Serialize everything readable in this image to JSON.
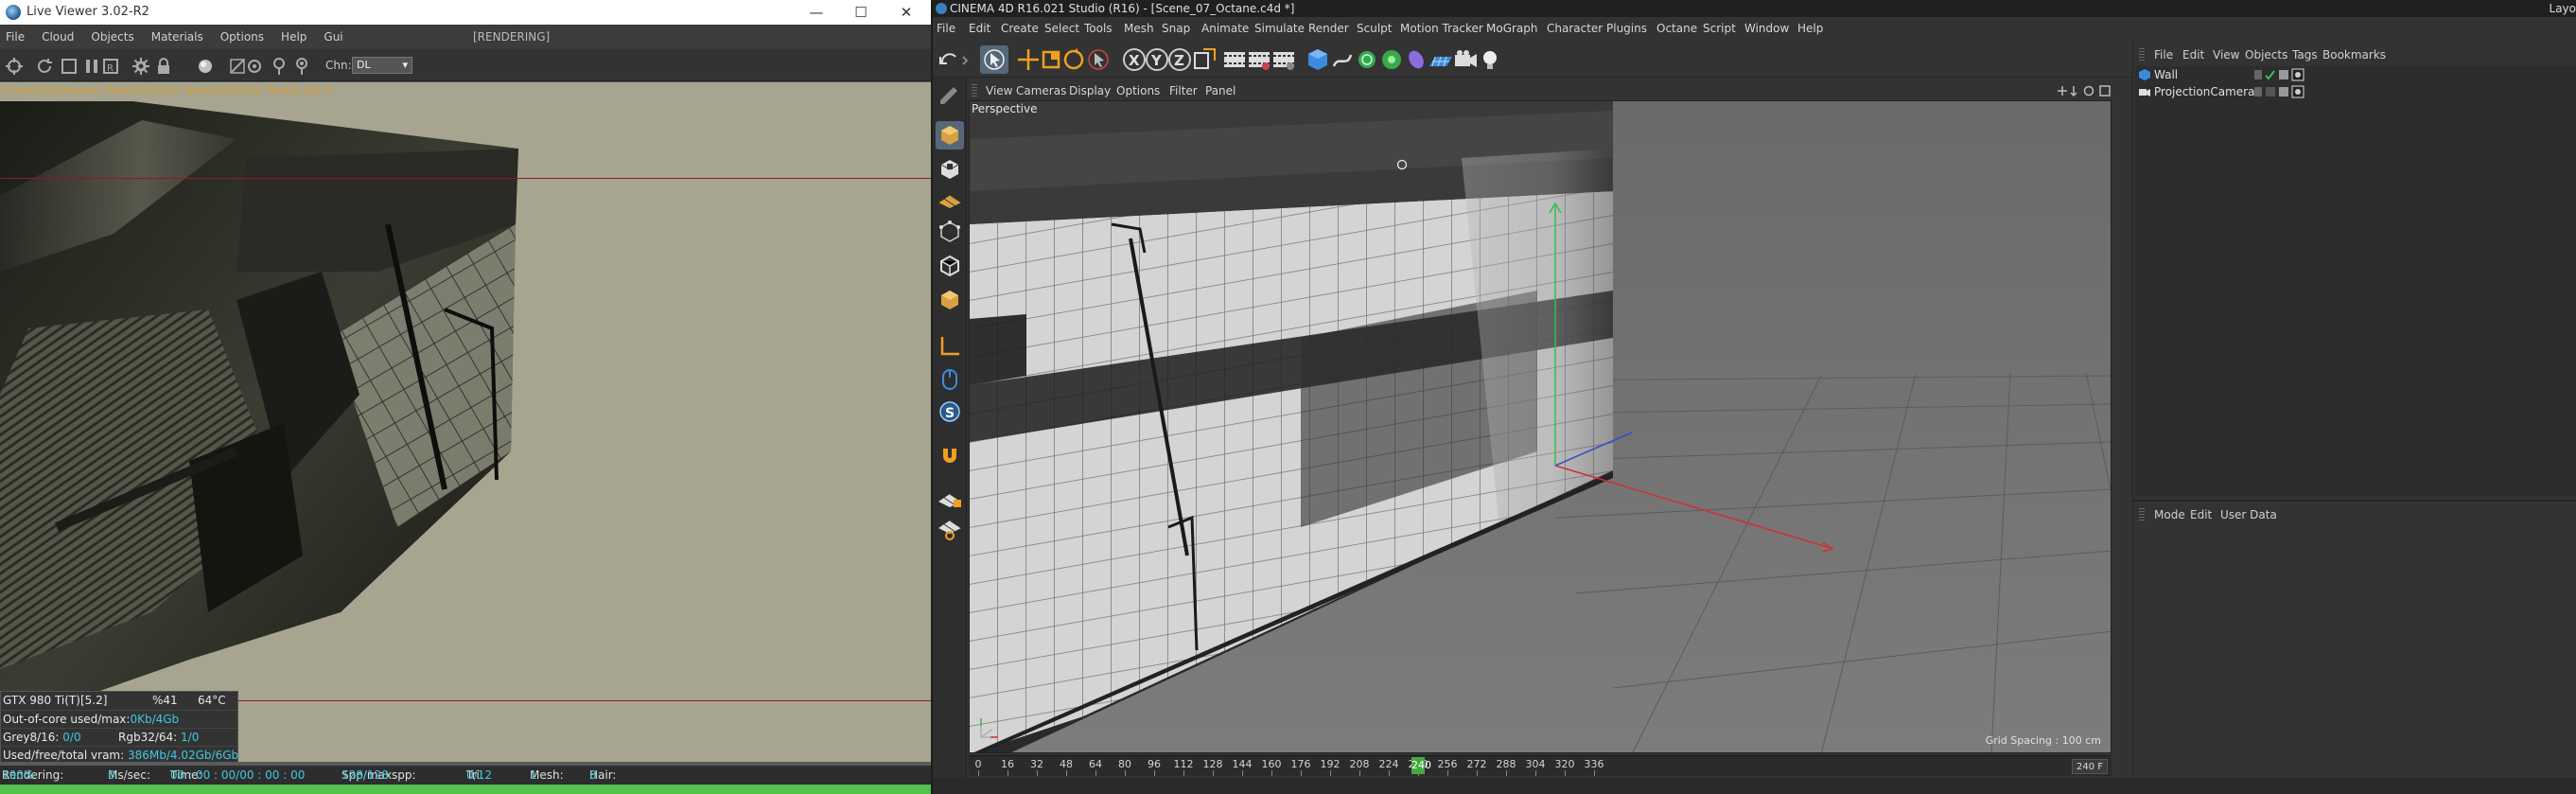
{
  "live_viewer": {
    "title": "Live Viewer 3.02-R2",
    "window_controls": {
      "minimize": "—",
      "maximize": "☐",
      "close": "✕"
    },
    "menu": [
      "File",
      "Cloud",
      "Objects",
      "Materials",
      "Options",
      "Help",
      "Gui"
    ],
    "status": "[RENDERING]",
    "channel_label": "Chn:",
    "channel_value": "DL",
    "warning": "CheckDirtyMeshes: MeshGenDirty Update(G)Dirty: Nodes Fail 0",
    "gpu": {
      "name": "GTX 980 Ti(T)[5.2]",
      "usage": "%41",
      "temp": "64°C",
      "out_of_core_label": "Out-of-core used/max:",
      "out_of_core_value": "0Kb/4Gb",
      "grey_label": "Grey8/16:",
      "grey_value": "0/0",
      "rgb_label": "Rgb32/64:",
      "rgb_value": "1/0",
      "vram_label": "Used/free/total vram:",
      "vram_value": "386Mb/4.02Gb/6Gb"
    },
    "footer": {
      "rendering_label": "Rendering:",
      "rendering_value": "100%",
      "ms_label": "Ms/sec:",
      "ms_value": "0",
      "time_label": "Time:",
      "time_value": "00 : 00 : 00/00 : 00 : 00",
      "spp_label": "Spp/maxspp:",
      "spp_value": "128/128",
      "tri_label": "Tri:",
      "tri_value": "0/12",
      "mesh_label": "Mesh:",
      "mesh_value": "1",
      "hair_label": "Hair:",
      "hair_value": "0"
    },
    "progress": 1.0
  },
  "c4d": {
    "title": "CINEMA 4D R16.021 Studio (R16) - [Scene_07_Octane.c4d *]",
    "layout_label": "Layo",
    "menu": [
      "File",
      "Edit",
      "Create",
      "Select",
      "Tools",
      "Mesh",
      "Snap",
      "Animate",
      "Simulate",
      "Render",
      "Sculpt",
      "Motion Tracker",
      "MoGraph",
      "Character",
      "Plugins",
      "Octane",
      "Script",
      "Window",
      "Help"
    ],
    "viewport_menu": [
      "View",
      "Cameras",
      "Display",
      "Options",
      "Filter",
      "Panel"
    ],
    "viewport_label": "Perspective",
    "grid_spacing": "Grid Spacing : 100 cm",
    "axis_labels": {
      "x": "X",
      "y": "Y",
      "z": "Z"
    },
    "timeline": {
      "ticks": [
        "0",
        "16",
        "32",
        "48",
        "64",
        "80",
        "96",
        "112",
        "128",
        "144",
        "160",
        "176",
        "192",
        "208",
        "224",
        "240",
        "256",
        "272",
        "288",
        "304",
        "320",
        "336"
      ],
      "current": "240",
      "end_frame": "240 F"
    },
    "object_manager": {
      "menu": [
        "File",
        "Edit",
        "View",
        "Objects",
        "Tags",
        "Bookmarks"
      ],
      "objects": [
        {
          "name": "Wall"
        },
        {
          "name": "ProjectionCamera"
        }
      ]
    },
    "attribute_manager": {
      "menu": [
        "Mode",
        "Edit",
        "User Data"
      ]
    }
  }
}
